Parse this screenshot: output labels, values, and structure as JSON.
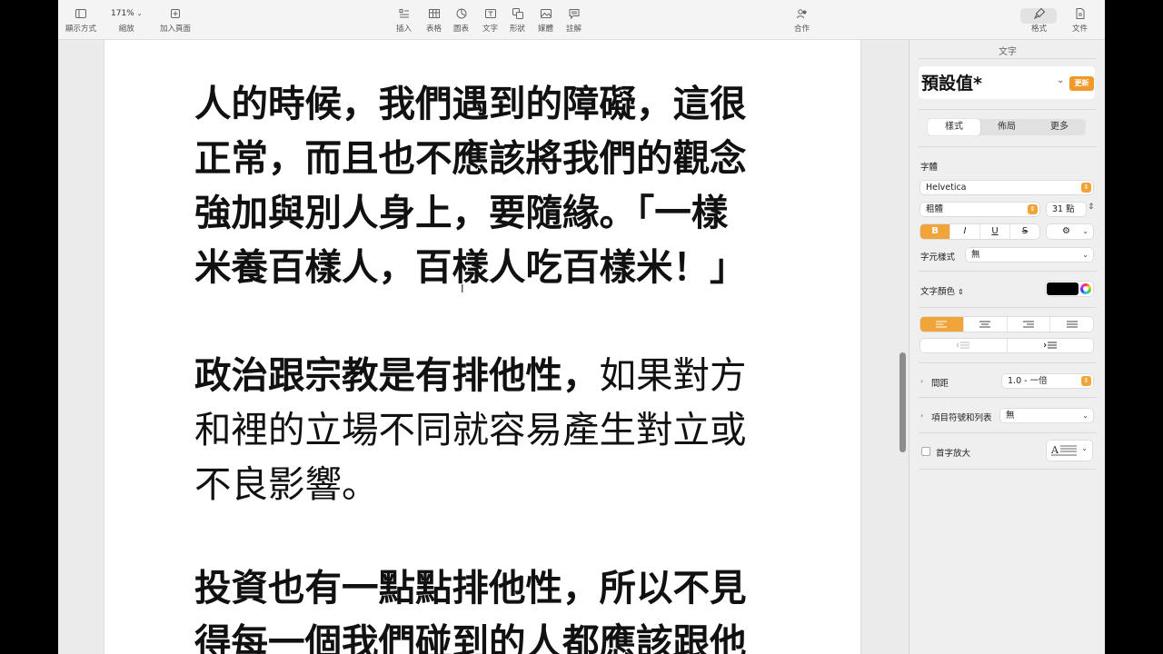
{
  "toolbar": {
    "view": {
      "label": "顯示方式",
      "icon": "sidebar-icon"
    },
    "zoom": {
      "value": "171%",
      "label": "縮放"
    },
    "add_page": {
      "label": "加入頁面",
      "icon": "plus-square-icon"
    },
    "insert": {
      "label": "插入",
      "icon": "list-insert-icon"
    },
    "table": {
      "label": "表格",
      "icon": "table-icon"
    },
    "chart": {
      "label": "圖表",
      "icon": "chart-icon"
    },
    "text": {
      "label": "文字",
      "icon": "text-box-icon"
    },
    "shape": {
      "label": "形狀",
      "icon": "shape-icon"
    },
    "media": {
      "label": "媒體",
      "icon": "media-icon"
    },
    "comment": {
      "label": "註解",
      "icon": "comment-icon"
    },
    "collaborate": {
      "label": "合作",
      "icon": "collaborate-icon"
    },
    "format": {
      "label": "格式",
      "icon": "paintbrush-icon"
    },
    "document": {
      "label": "文件",
      "icon": "document-icon"
    }
  },
  "document": {
    "paragraphs": [
      {
        "lines": [
          {
            "text": "人的時候，我們遇到的障礙，這很",
            "style": "bold"
          },
          {
            "text": "正常，而且也不應該將我們的觀念",
            "style": "bold"
          },
          {
            "text": "強加與別人身上，要隨緣。「一樣",
            "style": "bold"
          },
          {
            "text": "米養百樣人，百樣人吃百樣米！」",
            "style": "bold"
          }
        ]
      },
      {
        "lines": [
          {
            "bold_part": "政治跟宗教是有排他性，",
            "normal_part": "如果對方"
          },
          {
            "bold_part": "",
            "normal_part": "和裡的立場不同就容易產生對立或"
          },
          {
            "bold_part": "",
            "normal_part": "不良影響。"
          }
        ]
      },
      {
        "lines": [
          {
            "text": "投資也有一點點排他性，所以不見",
            "style": "bold"
          },
          {
            "text": "得每一個我們碰到的人都應該跟他",
            "style": "bold"
          }
        ]
      }
    ]
  },
  "sidebar": {
    "title": "文字",
    "paragraph_style": "預設值*",
    "update_button": "更新",
    "tabs": [
      {
        "label": "樣式",
        "active": true
      },
      {
        "label": "佈局",
        "active": false
      },
      {
        "label": "更多",
        "active": false
      }
    ],
    "font_label": "字體",
    "font_family": "Helvetica",
    "font_weight": "粗體",
    "font_size": "31 點",
    "format_buttons": [
      "B",
      "I",
      "U",
      "S"
    ],
    "char_style_label": "字元樣式",
    "char_style_value": "無",
    "text_color_label": "文字顏色",
    "text_color": "#000000",
    "accent_color": "#f0a43a",
    "spacing_label": "間距",
    "spacing_value": "1.0 - 一倍",
    "bullets_label": "項目符號和列表",
    "bullets_value": "無",
    "dropcap_label": "首字放大"
  }
}
